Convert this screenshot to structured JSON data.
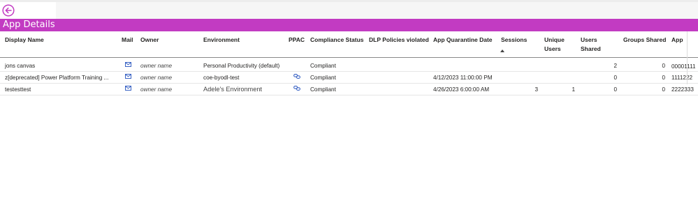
{
  "title": "App Details",
  "columns": {
    "display_name": "Display Name",
    "mail": "Mail",
    "owner": "Owner",
    "environment": "Environment",
    "ppac": "PPAC",
    "compliance_status": "Compliance Status",
    "dlp_policies": "DLP Policies violated",
    "quarantine_date": "App Quarantine Date",
    "sessions": "Sessions",
    "unique_users_1": "Unique",
    "unique_users_2": "Users",
    "users_shared_1": "Users",
    "users_shared_2": "Shared",
    "groups_shared": "Groups Shared",
    "app": "App"
  },
  "rows": [
    {
      "display_name": "jons canvas",
      "owner": "owner name",
      "environment": "Personal Productivity (default)",
      "compliance": "Compliant",
      "quarantine_date": "",
      "sessions": "",
      "unique_users": "",
      "users_shared": "2",
      "groups_shared": "0",
      "app": "00001111"
    },
    {
      "display_name": "z[deprecated] Power Platform Training ...",
      "owner": "owner name",
      "environment": "coe-byodl-test",
      "compliance": "Compliant",
      "quarantine_date": "4/12/2023 11:00:00 PM",
      "sessions": "",
      "unique_users": "",
      "users_shared": "0",
      "groups_shared": "0",
      "app": "1111222"
    },
    {
      "display_name": "testesttest",
      "owner": "owner name",
      "environment": "Adele's Environment",
      "compliance": "Compliant",
      "quarantine_date": "4/26/2023 6:00:00 AM",
      "sessions": "3",
      "unique_users": "1",
      "users_shared": "0",
      "groups_shared": "0",
      "app": "2222333"
    }
  ],
  "icons": {
    "back": "back-arrow-icon",
    "mail": "mail-icon",
    "link": "link-icon"
  },
  "colors": {
    "accent": "#c23bc2",
    "icon_blue": "#3a63c4"
  }
}
